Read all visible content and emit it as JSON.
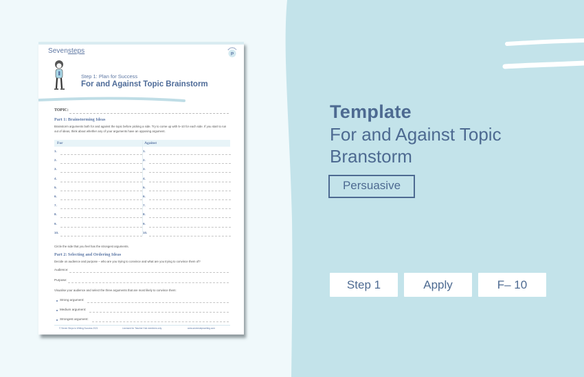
{
  "colors": {
    "page_bg": "#f0f9fb",
    "panel_bg": "#c3e3ea",
    "accent": "#4d6a91",
    "doc_heading": "#5d78a6",
    "white": "#ffffff"
  },
  "document": {
    "brand_prefix": "Seven",
    "brand_suffix": "steps",
    "badge_letter": "P",
    "kicker": "Step 1: Plan for Success",
    "title": "For and Against Topic Brainstorm",
    "topic_label": "TOPIC:",
    "part1": {
      "heading": "Part 1: Brainstorming Ideas",
      "instructions": "Brainstorm arguments both for and against the topic before picking a side. Try to come up with 5–10 for each side. If you start to run out of ideas, think about whether any of your arguments have an opposing argument.",
      "columns": [
        "For",
        "Against"
      ],
      "row_numbers": [
        "1.",
        "2.",
        "3.",
        "4.",
        "5.",
        "6.",
        "7.",
        "8.",
        "9.",
        "10."
      ]
    },
    "circle_note": "Circle the side that you feel has the strongest arguments.",
    "part2": {
      "heading": "Part 2: Selecting and Ordering Ideas",
      "instructions": "Decide on audience and purpose – who are you trying to convince and what are you trying to convince them of?",
      "audience_label": "Audience:",
      "purpose_label": "Purpose:",
      "visualise": "Visualise your audience and select the three arguments that are most likely to convince them:",
      "arguments": [
        "Strong argument:",
        "Medium argument:",
        "Strongest argument:"
      ]
    },
    "footer": {
      "copyright": "© Seven Steps to Writing Success 2021",
      "license": "Licensed for Teacher Hub members only",
      "website": "www.sevenstepswriting.com"
    },
    "tab_colors": [
      "#cbe6ee",
      "#f6cf5c",
      "#7cc8b4",
      "#e39a9a",
      "#d9624f",
      "#eea35a",
      "#8d6aa3"
    ]
  },
  "info": {
    "type_label": "Template",
    "name": "For and Against Topic Branstorm",
    "genre_tag": "Persuasive",
    "chips": [
      "Step 1",
      "Apply",
      "F– 10"
    ]
  }
}
